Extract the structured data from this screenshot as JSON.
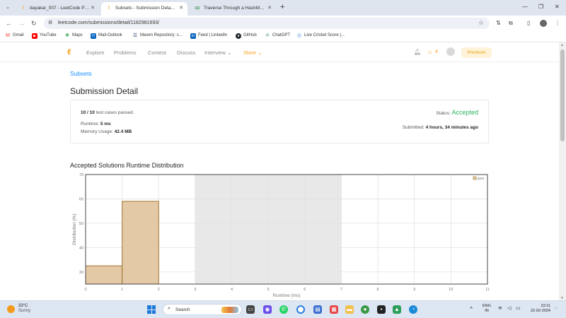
{
  "browser": {
    "tabs": [
      {
        "title": "dayakar_007 - LeetCode Profile",
        "active": false,
        "icon": "leetcode-icon"
      },
      {
        "title": "Subsets - Submission Detail - LeetCode",
        "active": true,
        "icon": "leetcode-icon"
      },
      {
        "title": "Traverse Through a HashMap in Java",
        "active": false,
        "icon": "gfg-icon"
      }
    ],
    "url": "leetcode.com/submissions/detail/1182981693/",
    "bookmarks": [
      {
        "label": "Gmail",
        "icon": "gmail-icon",
        "color": "#ea4335"
      },
      {
        "label": "YouTube",
        "icon": "youtube-icon",
        "color": "#ff0000"
      },
      {
        "label": "Maps",
        "icon": "maps-icon",
        "color": "#34a853"
      },
      {
        "label": "Mail-Outlook",
        "icon": "outlook-icon",
        "color": "#0a64c2"
      },
      {
        "label": "Maven Repository: c...",
        "icon": "maven-icon",
        "color": "#1f3a64"
      },
      {
        "label": "Feed | LinkedIn",
        "icon": "linkedin-icon",
        "color": "#0a66c2"
      },
      {
        "label": "GitHub",
        "icon": "github-icon",
        "color": "#24292f"
      },
      {
        "label": "ChatGPT",
        "icon": "chatgpt-icon",
        "color": "#74aa9c"
      },
      {
        "label": "Live Cricket Score |...",
        "icon": "cricket-icon",
        "color": "#4a90d9"
      }
    ]
  },
  "lc_nav": {
    "links": [
      "Explore",
      "Problems",
      "Contest",
      "Discuss",
      "Interview",
      "Store"
    ],
    "streak": "4",
    "premium": "Premium"
  },
  "page": {
    "breadcrumb": "Subsets",
    "title": "Submission Detail",
    "tests_passed": "10 / 10",
    "tests_label": "test cases passed.",
    "status_label": "Status:",
    "status": "Accepted",
    "runtime_label": "Runtime:",
    "runtime": "5 ms",
    "memory_label": "Memory Usage:",
    "memory": "42.4 MB",
    "submitted_label": "Submitted:",
    "submitted": "4 hours, 34 minutes ago",
    "distribution_title": "Accepted Solutions Runtime Distribution"
  },
  "chart_data": {
    "type": "bar",
    "xlabel": "Runtime (ms)",
    "ylabel": "Distribution (%)",
    "xlim": [
      0,
      11
    ],
    "ylim": [
      25,
      70
    ],
    "xticks": [
      0,
      1,
      2,
      3,
      4,
      5,
      6,
      7,
      8,
      9,
      10,
      11
    ],
    "yticks": [
      30,
      40,
      50,
      60,
      70
    ],
    "bins": [
      {
        "x0": 0,
        "x1": 1,
        "value": 32.5
      },
      {
        "x0": 1,
        "x1": 2,
        "value": 59
      }
    ],
    "highlight_range": [
      3,
      7
    ],
    "legend": {
      "label": "java",
      "position": "top-right"
    },
    "bar_color": "#e4c9a6",
    "bar_stroke": "#a0752f"
  },
  "taskbar": {
    "temp": "33°C",
    "weather": "Sunny",
    "search": "Search",
    "lang_top": "ENG",
    "lang_bottom": "IN",
    "time": "22:11",
    "date": "22-02-2024"
  }
}
